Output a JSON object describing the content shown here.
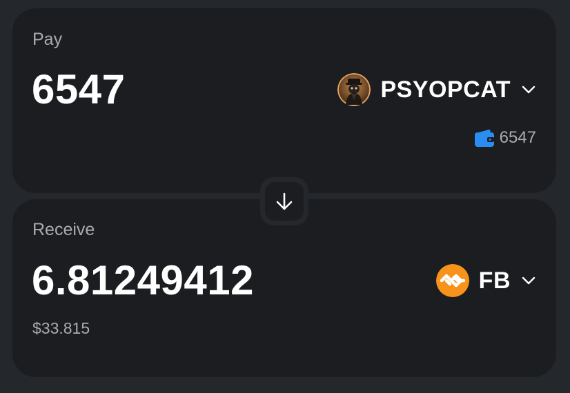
{
  "pay": {
    "label": "Pay",
    "amount": "6547",
    "token": {
      "symbol": "PSYOPCAT",
      "icon": "psyopcat-avatar-icon"
    },
    "balance": "6547"
  },
  "receive": {
    "label": "Receive",
    "amount": "6.81249412",
    "usd_value": "$33.815",
    "token": {
      "symbol": "FB",
      "icon": "fb-token-icon",
      "color": "#f7931a"
    }
  },
  "colors": {
    "background": "#24272b",
    "card": "#1b1d21",
    "text": "#ffffff",
    "muted": "#a9abae",
    "wallet": "#2b8cf2"
  }
}
